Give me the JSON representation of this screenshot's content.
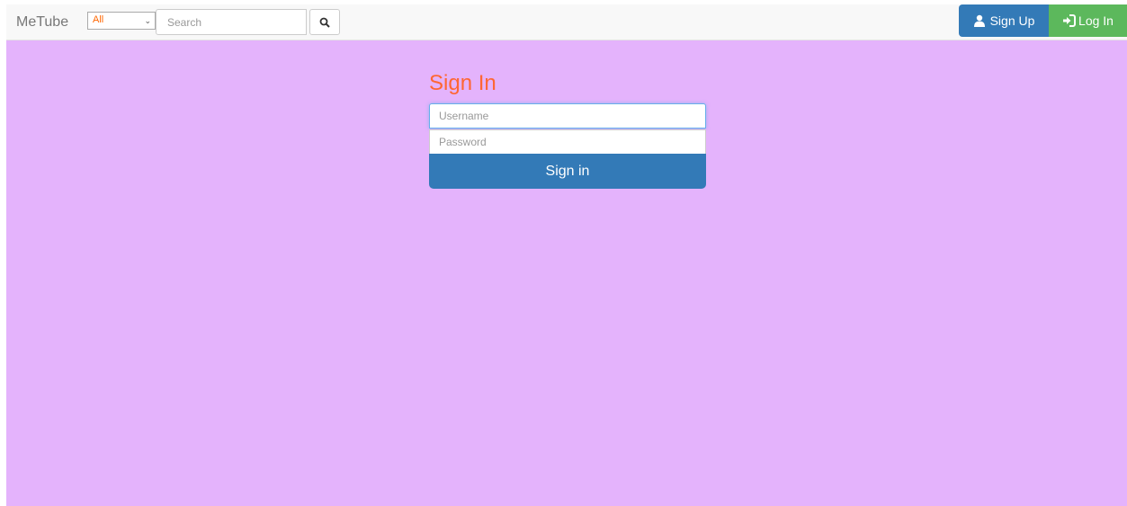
{
  "navbar": {
    "brand": "MeTube",
    "category_select": {
      "selected": "All"
    },
    "search": {
      "placeholder": "Search",
      "value": ""
    },
    "signup_label": "Sign Up",
    "login_label": "Log In"
  },
  "signin_form": {
    "title": "Sign In",
    "username_placeholder": "Username",
    "password_placeholder": "Password",
    "submit_label": "Sign in"
  },
  "colors": {
    "background": "#e4b3fc",
    "navbar": "#f8f8f8",
    "title": "#ff6633",
    "primary": "#337ab7",
    "success": "#5cb85c",
    "select_text": "#ff6600"
  },
  "icons": {
    "search": "search-icon",
    "signup": "user-icon",
    "login": "log-in-icon"
  }
}
